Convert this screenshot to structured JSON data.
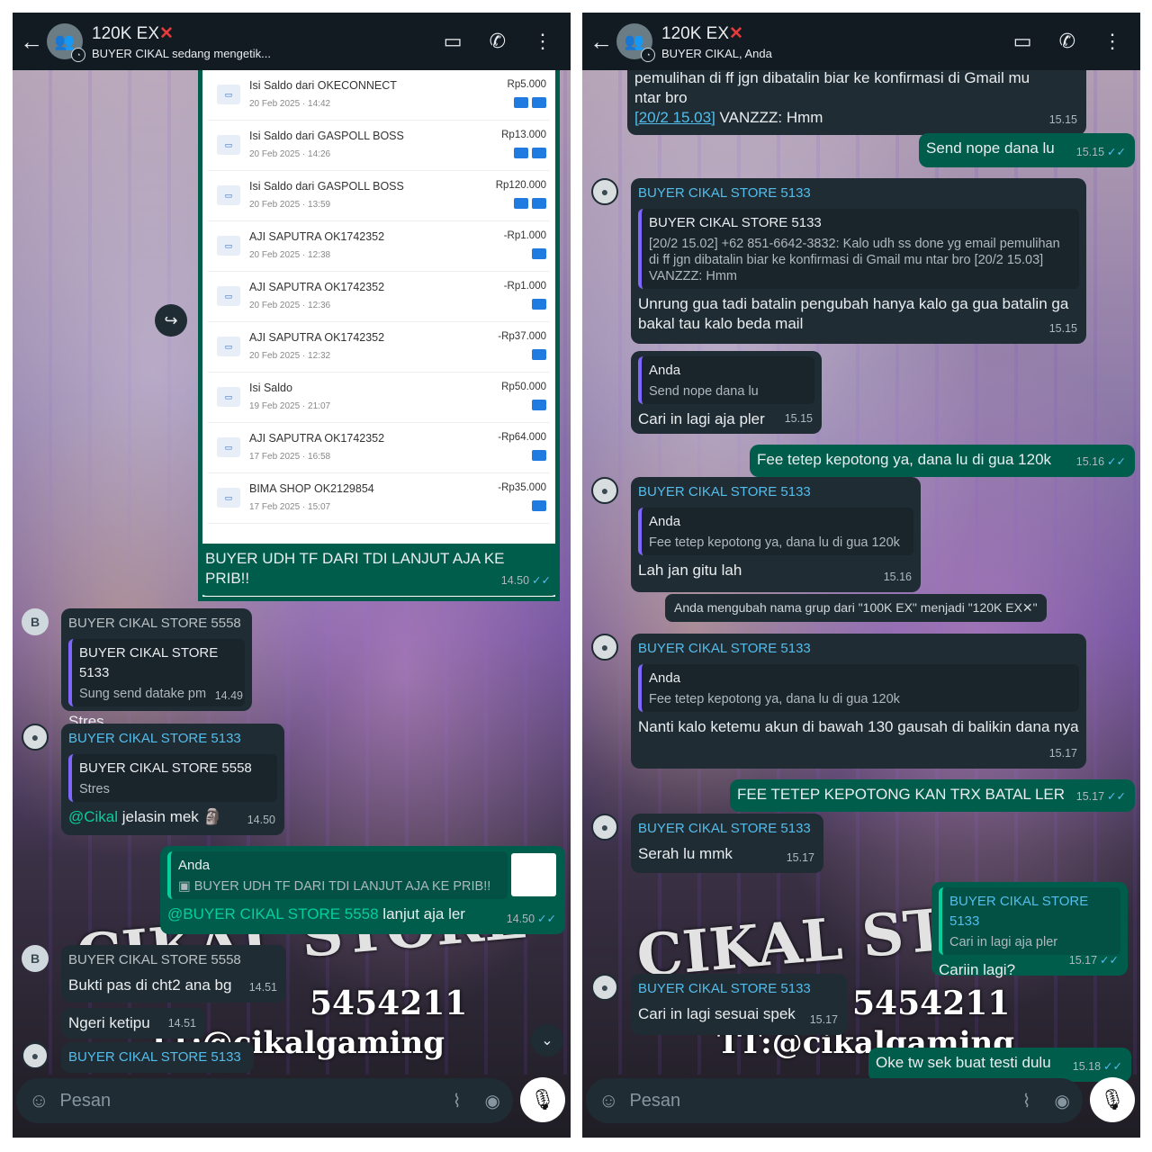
{
  "left": {
    "header": {
      "back": "←",
      "title": "120K EX",
      "title_mark": "✕",
      "subtitle": "BUYER CIKAL sedang mengetik..."
    },
    "forward_icon": "↪",
    "screenshot_rows": [
      {
        "title": "Isi Saldo dari OKECONNECT",
        "date": "20 Feb 2025 · 14:42",
        "amount": "Rp5.000"
      },
      {
        "title": "Isi Saldo dari GASPOLL BOSS",
        "date": "20 Feb 2025 · 14:26",
        "amount": "Rp13.000"
      },
      {
        "title": "Isi Saldo dari GASPOLL BOSS",
        "date": "20 Feb 2025 · 13:59",
        "amount": "Rp120.000"
      },
      {
        "title": "AJI SAPUTRA OK1742352",
        "date": "20 Feb 2025 · 12:38",
        "amount": "-Rp1.000"
      },
      {
        "title": "AJI SAPUTRA OK1742352",
        "date": "20 Feb 2025 · 12:36",
        "amount": "-Rp1.000"
      },
      {
        "title": "AJI SAPUTRA OK1742352",
        "date": "20 Feb 2025 · 12:32",
        "amount": "-Rp37.000"
      },
      {
        "title": "Isi Saldo",
        "date": "19 Feb 2025 · 21:07",
        "amount": "Rp50.000"
      },
      {
        "title": "AJI SAPUTRA OK1742352",
        "date": "17 Feb 2025 · 16:58",
        "amount": "-Rp64.000"
      },
      {
        "title": "BIMA SHOP OK2129854",
        "date": "17 Feb 2025 · 15:07",
        "amount": "-Rp35.000"
      }
    ],
    "m1": {
      "text": "BUYER UDH TF DARI TDI LANJUT AJA KE PRIB!!",
      "time": "14.50"
    },
    "m2": {
      "avatar": "B",
      "sender": "BUYER CIKAL STORE 5558",
      "qname": "BUYER CIKAL STORE 5133",
      "qtext": "Sung send datake pm",
      "text": "Stres",
      "time": "14.49"
    },
    "m3": {
      "sender": "BUYER CIKAL STORE 5133",
      "qname": "BUYER CIKAL STORE 5558",
      "qtext": "Stres",
      "mention": "@Cikal",
      "text": " jelasin mek 🗿",
      "time": "14.50"
    },
    "m4": {
      "qname": "Anda",
      "qtext": "▣ BUYER UDH TF DARI TDI LANJUT AJA KE PRIB!!",
      "mention": "@BUYER CIKAL STORE 5558",
      "text": " lanjut aja ler",
      "time": "14.50"
    },
    "m5": {
      "avatar": "B",
      "sender": "BUYER CIKAL STORE 5558",
      "text": "Bukti pas di cht2 ana bg",
      "time": "14.51"
    },
    "m6": {
      "text": "Ngeri ketipu",
      "time": "14.51"
    },
    "m7": {
      "sender": "BUYER CIKAL STORE 5133"
    },
    "scroll_icon": "⌄",
    "input": {
      "placeholder": "Pesan"
    }
  },
  "right": {
    "header": {
      "back": "←",
      "title": "120K EX",
      "title_mark": "✕",
      "subtitle": "BUYER CIKAL, Anda"
    },
    "r0": {
      "text1": "pemulihan di ff jgn  dibatalin biar ke konfirmasi di Gmail mu",
      "text2": "ntar bro",
      "link": "[20/2 15.03]",
      "text3": " VANZZZ: Hmm",
      "time": "15.15"
    },
    "r1": {
      "text": "Send nope dana lu",
      "time": "15.15"
    },
    "r2": {
      "sender": "BUYER CIKAL STORE 5133",
      "qname": "BUYER CIKAL STORE 5133",
      "qtext": "[20/2 15.02] +62 851-6642-3832: Kalo udh ss done yg email pemulihan di ff jgn  dibatalin biar ke konfirmasi di Gmail mu ntar bro [20/2 15.03] VANZZZ: Hmm",
      "text": "Unrung gua tadi batalin pengubah hanya kalo ga gua batalin ga bakal tau  kalo beda mail",
      "time": "15.15"
    },
    "r3": {
      "qname": "Anda",
      "qtext": "Send nope dana lu",
      "text": "Cari in lagi aja pler",
      "time": "15.15"
    },
    "r4": {
      "text": "Fee tetep kepotong ya, dana lu di gua 120k",
      "time": "15.16"
    },
    "r5": {
      "sender": "BUYER CIKAL STORE 5133",
      "qname": "Anda",
      "qtext": "Fee tetep kepotong ya, dana lu di gua 120k",
      "text": "Lah jan gitu lah",
      "time": "15.16"
    },
    "system": "Anda mengubah nama grup dari \"100K EX\" menjadi \"120K EX✕\"",
    "r6": {
      "sender": "BUYER CIKAL STORE 5133",
      "qname": "Anda",
      "qtext": "Fee tetep kepotong ya, dana lu di gua 120k",
      "text": "Nanti kalo ketemu akun di bawah 130  gausah di balikin dana nya",
      "time": "15.17"
    },
    "r7": {
      "text": "FEE TETEP KEPOTONG KAN TRX BATAL LER",
      "time": "15.17"
    },
    "r8": {
      "sender": "BUYER CIKAL STORE 5133",
      "text": "Serah lu mmk",
      "time": "15.17"
    },
    "r9": {
      "qname": "BUYER CIKAL STORE 5133",
      "qtext": "Cari in lagi aja pler",
      "text": "Cariin lagi?",
      "time": "15.17"
    },
    "r10": {
      "sender": "BUYER CIKAL STORE 5133",
      "text": "Cari in lagi sesuai spek",
      "time": "15.17"
    },
    "r11": {
      "text": "Oke tw sek buat testi dulu",
      "time": "15.18"
    },
    "input": {
      "placeholder": "Pesan"
    }
  },
  "icons": {
    "tick": "✓✓",
    "video": "▭",
    "call": "✆",
    "menu": "⋮",
    "emoji": "☺",
    "attach": "⌇",
    "camera": "◉",
    "mic": "🎙"
  },
  "background_overlay": {
    "brand": "CIKAL STORE",
    "number": "5454211",
    "tt": "TT:@cikalgaming"
  }
}
